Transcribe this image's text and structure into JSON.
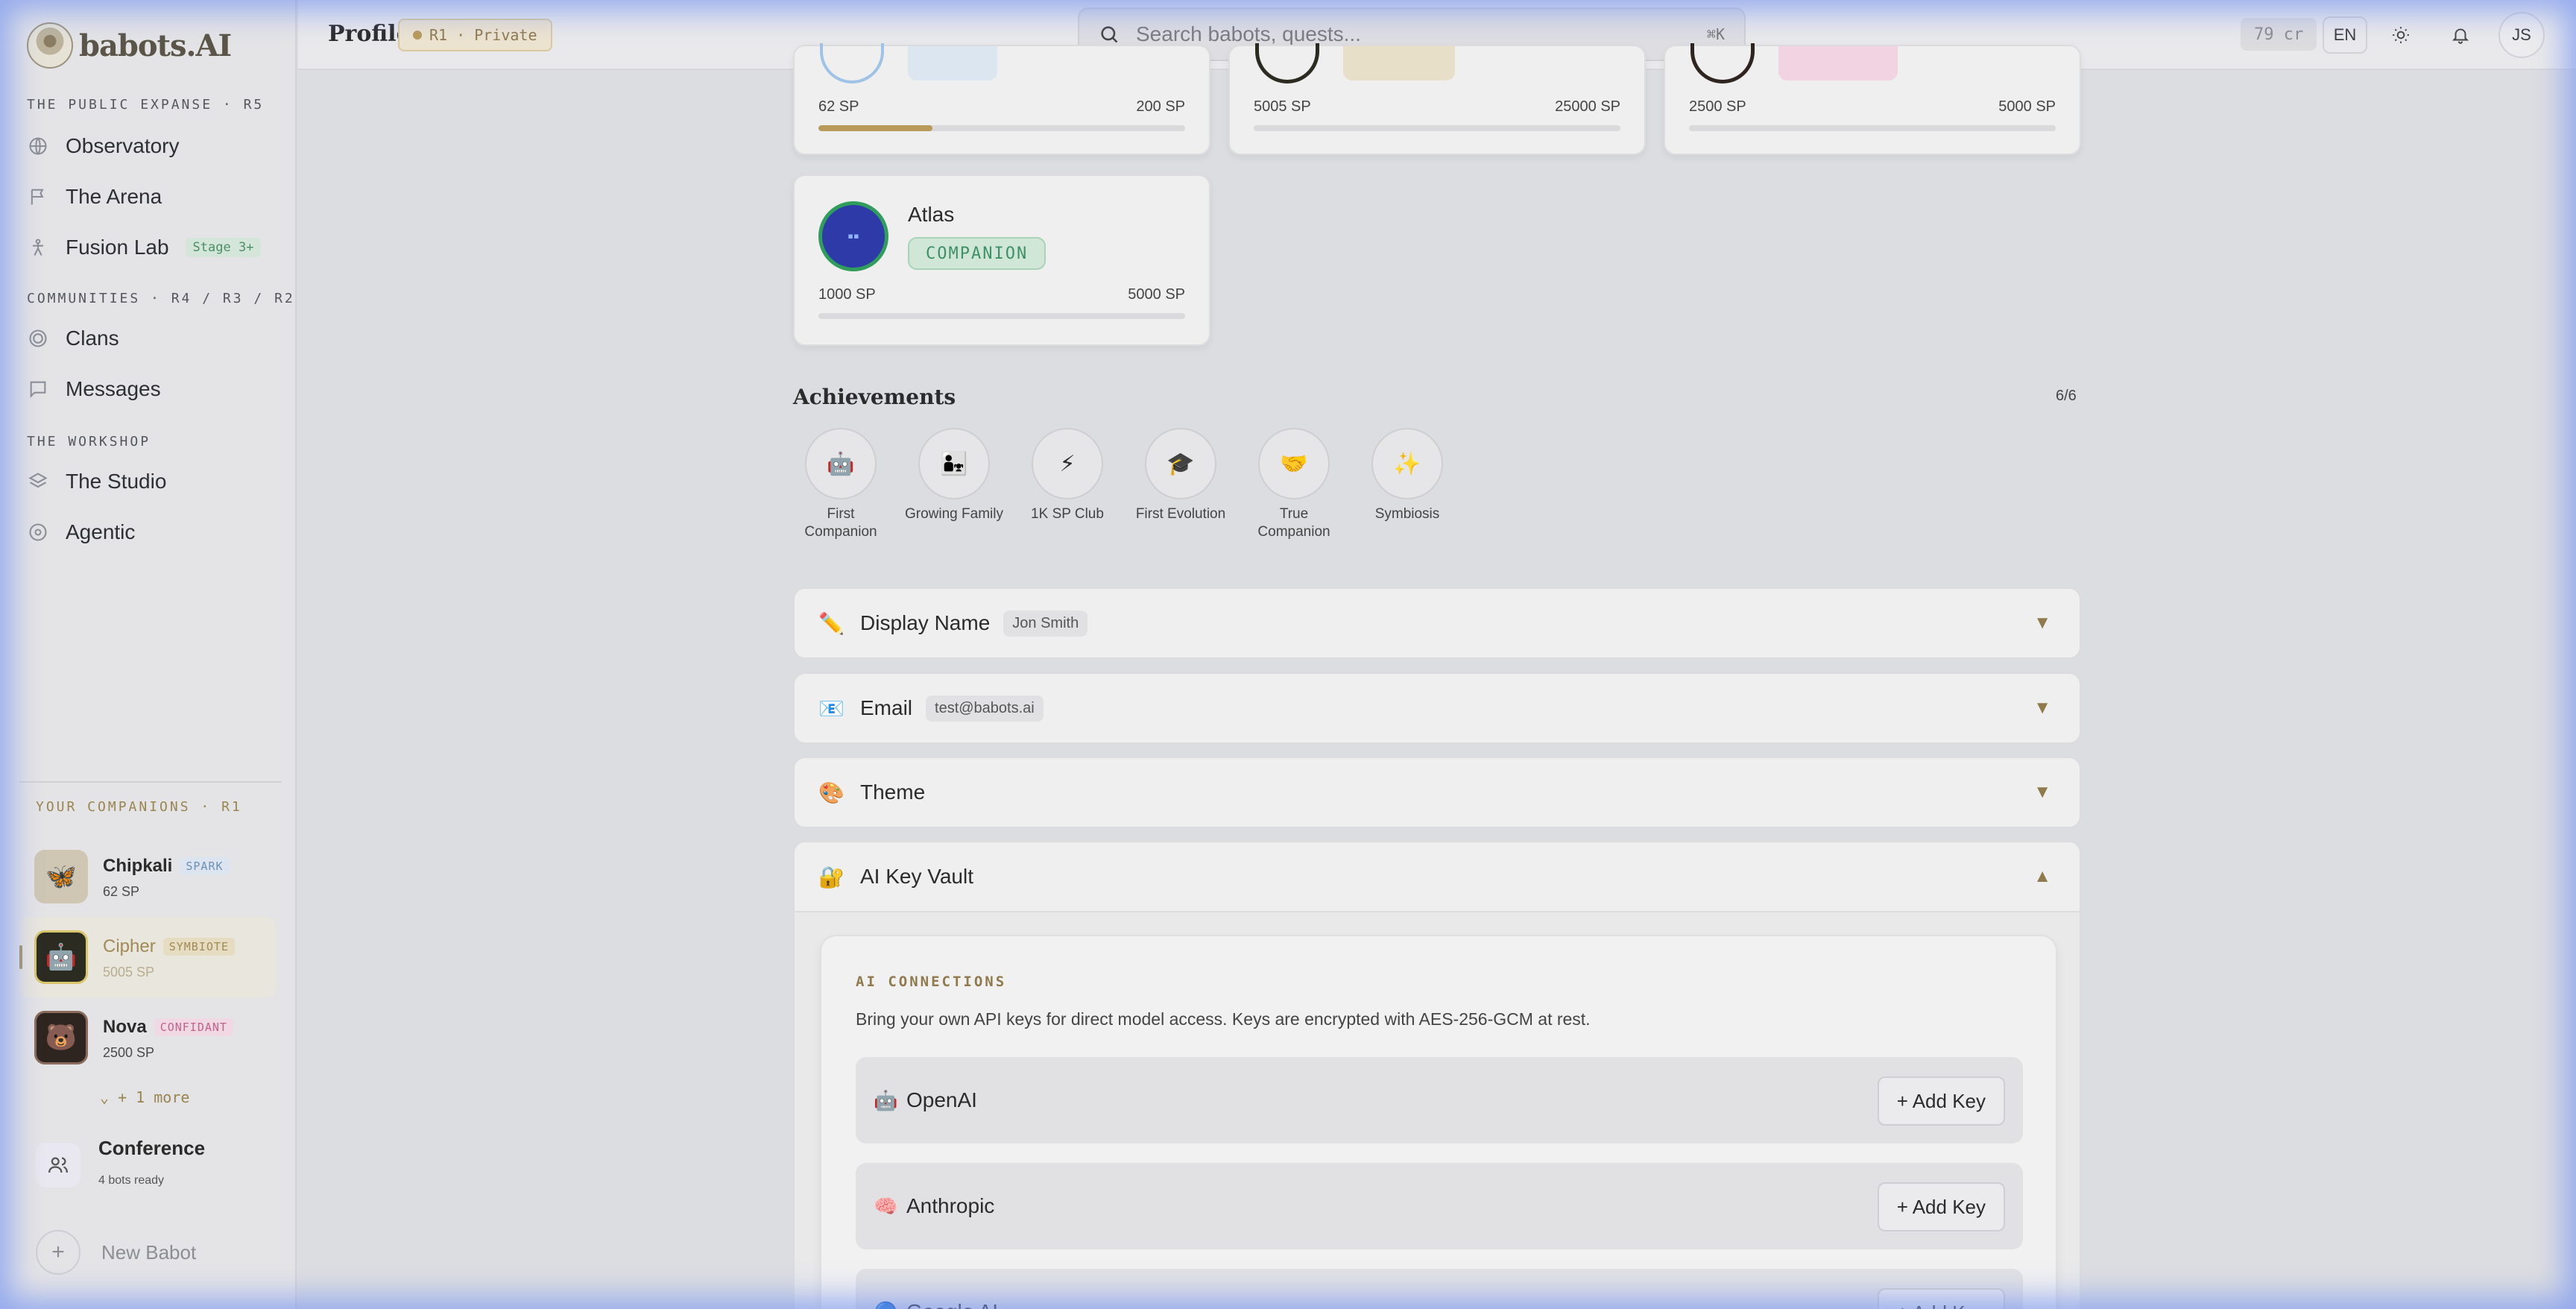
{
  "app": {
    "logo_text": "babots.AI"
  },
  "header": {
    "title": "Profile",
    "privacy_label": "R1 · Private",
    "search_placeholder": "Search babots, quests...",
    "search_shortcut": "⌘K",
    "credits": "79 cr",
    "language": "EN",
    "user_initials": "JS"
  },
  "sidebar": {
    "sections": [
      {
        "label": "THE PUBLIC EXPANSE · R5",
        "items": [
          {
            "label": "Observatory",
            "icon": "globe-icon"
          },
          {
            "label": "The Arena",
            "icon": "flag-icon"
          },
          {
            "label": "Fusion Lab",
            "icon": "fusion-icon",
            "badge": "Stage 3+"
          }
        ]
      },
      {
        "label": "COMMUNITIES · R4 / R3 / R2",
        "items": [
          {
            "label": "Clans",
            "icon": "target-icon"
          },
          {
            "label": "Messages",
            "icon": "message-icon"
          }
        ]
      },
      {
        "label": "THE WORKSHOP",
        "items": [
          {
            "label": "The Studio",
            "icon": "layers-icon"
          },
          {
            "label": "Agentic",
            "icon": "agentic-icon"
          }
        ]
      }
    ],
    "companions_label": "YOUR COMPANIONS · R1",
    "companions": [
      {
        "name": "Chipkali",
        "badge": "SPARK",
        "sp": "62 SP",
        "icon": "butterfly-icon"
      },
      {
        "name": "Cipher",
        "badge": "SYMBIOTE",
        "sp": "5005 SP",
        "icon": "robot-icon"
      },
      {
        "name": "Nova",
        "badge": "CONFIDANT",
        "sp": "2500 SP",
        "icon": "bear-icon"
      }
    ],
    "more_label": "+ 1 more",
    "conference": {
      "title": "Conference",
      "subtitle": "4 bots ready"
    },
    "new_babot": "New Babot"
  },
  "bots": [
    {
      "sp_current": "62 SP",
      "sp_next": "200 SP",
      "progress": 0.31
    },
    {
      "sp_current": "5005 SP",
      "sp_next": "25000 SP",
      "progress": 0.0
    },
    {
      "sp_current": "2500 SP",
      "sp_next": "5000 SP",
      "progress": 0.0
    },
    {
      "name": "Atlas",
      "role": "COMPANION",
      "sp_current": "1000 SP",
      "sp_next": "5000 SP",
      "progress": 0.0
    }
  ],
  "achievements": {
    "title": "Achievements",
    "count": "6/6",
    "items": [
      {
        "label": "First Companion",
        "emoji": "🤖"
      },
      {
        "label": "Growing Family",
        "emoji": "👨‍👧"
      },
      {
        "label": "1K SP Club",
        "emoji": "⚡"
      },
      {
        "label": "First Evolution",
        "emoji": "🎓"
      },
      {
        "label": "True Companion",
        "emoji": "🤝"
      },
      {
        "label": "Symbiosis",
        "emoji": "✨"
      }
    ]
  },
  "settings": [
    {
      "emoji": "✏️",
      "title": "Display Name",
      "value": "Jon Smith"
    },
    {
      "emoji": "📧",
      "title": "Email",
      "value": "test@babots.ai"
    },
    {
      "emoji": "🎨",
      "title": "Theme"
    },
    {
      "emoji": "🔐",
      "title": "AI Key Vault"
    }
  ],
  "vault": {
    "label": "AI CONNECTIONS",
    "description": "Bring your own API keys for direct model access. Keys are encrypted with AES-256-GCM at rest.",
    "providers": [
      {
        "emoji": "🤖",
        "name": "OpenAI",
        "action": "+ Add Key"
      },
      {
        "emoji": "🧠",
        "name": "Anthropic",
        "action": "+ Add Key"
      },
      {
        "emoji": "🔵",
        "name": "Google AI",
        "action": "+ Add Key"
      }
    ]
  },
  "colors": {
    "accent": "#b89a5a",
    "companion_green": "#3e9066",
    "background": "#dcdde1"
  }
}
